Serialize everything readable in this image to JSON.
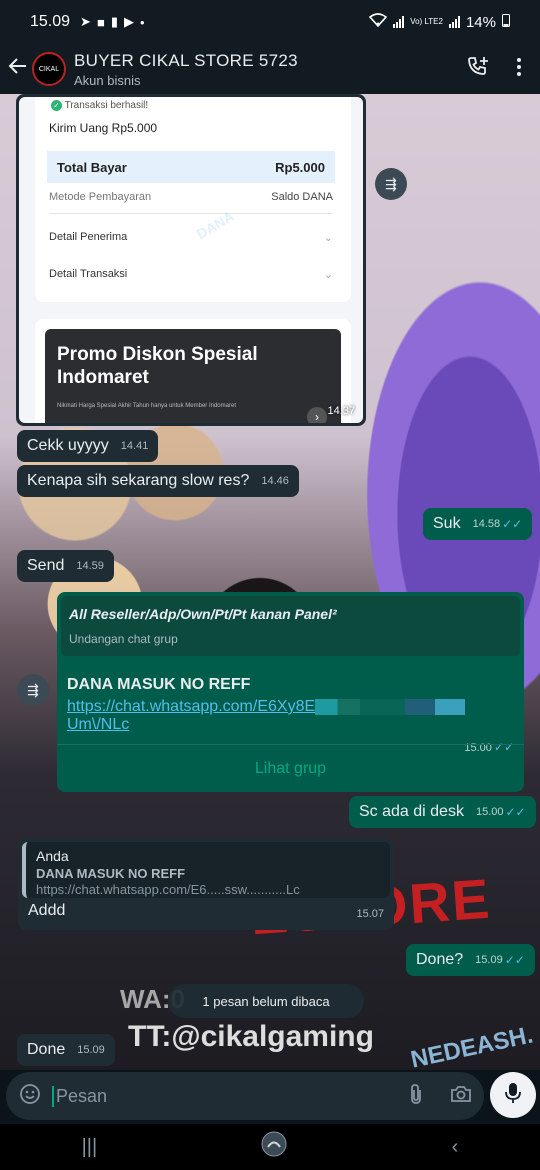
{
  "status_bar": {
    "time": "15.09",
    "battery": "14%",
    "network": "Vo) LTE2"
  },
  "header": {
    "avatar_text": "CIKAL",
    "contact_name": "BUYER CIKAL STORE 5723",
    "subtitle": "Akun bisnis"
  },
  "dana_receipt": {
    "status": "Transaksi berhasil!",
    "title": "Kirim Uang Rp5.000",
    "total_label": "Total Bayar",
    "total_value": "Rp5.000",
    "method_label": "Metode Pembayaran",
    "method_value": "Saldo DANA",
    "row1": "Detail Penerima",
    "row2": "Detail Transaksi",
    "promo_title": "Promo Diskon Spesial Indomaret",
    "promo_sub": "Nikmati Harga Spesial Akhir Tahun hanya untuk Member Indomaret",
    "watermark": "DANA",
    "time": "14.37"
  },
  "messages": [
    {
      "text": "Cekk uyyyy",
      "time": "14.41"
    },
    {
      "text": "Kenapa sih sekarang slow res?",
      "time": "14.46"
    },
    {
      "text": "Suk",
      "time": "14.58"
    },
    {
      "text": "Send",
      "time": "14.59"
    },
    {
      "text": "Sc ada di desk",
      "time": "15.00"
    },
    {
      "text": "Done?",
      "time": "15.09"
    },
    {
      "text": "Done",
      "time": "15.09"
    }
  ],
  "group_invite": {
    "group_name": "All Reseller/Adp/Own/Pt/Pt kanan Panel²",
    "invite_label": "Undangan chat grup",
    "text": "DANA MASUK NO REFF",
    "link_start": "https://chat.whatsapp.com/E6Xy8E",
    "link_end": "Um\\/NLc",
    "time": "15.00",
    "button": "Lihat grup"
  },
  "reply": {
    "author": "Anda",
    "quoted_text": "DANA MASUK NO REFF",
    "quoted_link": "https://chat.whatsapp.com/E6.....ssw...........Lc",
    "text": "Addd",
    "time": "15.07"
  },
  "unread_banner": "1 pesan belum dibaca",
  "watermarks": {
    "wa": "WA:0",
    "tt": "TT:@cikalgaming",
    "red": "ESTORE",
    "corner": "NEDEASH."
  },
  "composer": {
    "placeholder": "Pesan"
  },
  "colors": {
    "outgoing": "#005c4b",
    "incoming": "#202c33",
    "accent": "#00a884",
    "link": "#53bdeb"
  }
}
